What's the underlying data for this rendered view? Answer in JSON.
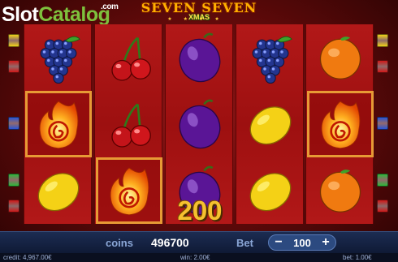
{
  "brand": {
    "slot": "Slot",
    "catalog": "Catalog",
    "com": ".com"
  },
  "game_logo": {
    "line1": "SEVEN SEVEN",
    "line2": "XMAS"
  },
  "reels": [
    [
      "grapes",
      "fireball",
      "lemon"
    ],
    [
      "cherries",
      "cherries",
      "fireball"
    ],
    [
      "plum",
      "plum",
      "plum"
    ],
    [
      "grapes",
      "lemon",
      "lemon"
    ],
    [
      "orange",
      "fireball",
      "orange"
    ]
  ],
  "winning_cells": [
    [
      0,
      1
    ],
    [
      1,
      2
    ],
    [
      4,
      1
    ]
  ],
  "win_amount": "200",
  "bottom_bar": {
    "coins_label": "coins",
    "coins_value": "496700",
    "bet_label": "Bet",
    "bet_value": "100",
    "bet_minus": "−",
    "bet_plus": "+"
  },
  "info_bar": {
    "credit": "credit: 4,967.00€",
    "win": "win: 2.00€",
    "bet": "bet: 1.00€"
  },
  "colors": {
    "win_border": "#e79a35",
    "win_amount": "#f5c02f",
    "bar_bg": "#1c2c52",
    "reel_bg": "#b21818",
    "markers_left": [
      "#f0d21a",
      "#d01818",
      "#2a56d8",
      "#2fb83a",
      "#d01818"
    ],
    "markers_right": [
      "#f0d21a",
      "#d01818",
      "#2a56d8",
      "#2fb83a",
      "#d01818"
    ]
  }
}
